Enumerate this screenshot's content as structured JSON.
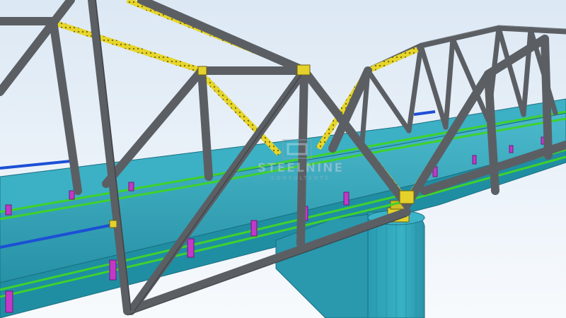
{
  "watermark": {
    "brand": "STEELNINE",
    "tagline": "CONSULTANTS"
  },
  "colors": {
    "sky_top": "#dce8f4",
    "sky_bottom": "#f7fafd",
    "truss_member": "#5b5f64",
    "truss_outline": "#2e3134",
    "bracing_highlight": "#e7d62a",
    "deck_slab": "#2ea3b8",
    "deck_slab_dark": "#1f7f93",
    "pier": "#2ea3b8",
    "guardrail": "#3fd22c",
    "post": "#c238c8",
    "blue_edge": "#1c4fd6"
  }
}
